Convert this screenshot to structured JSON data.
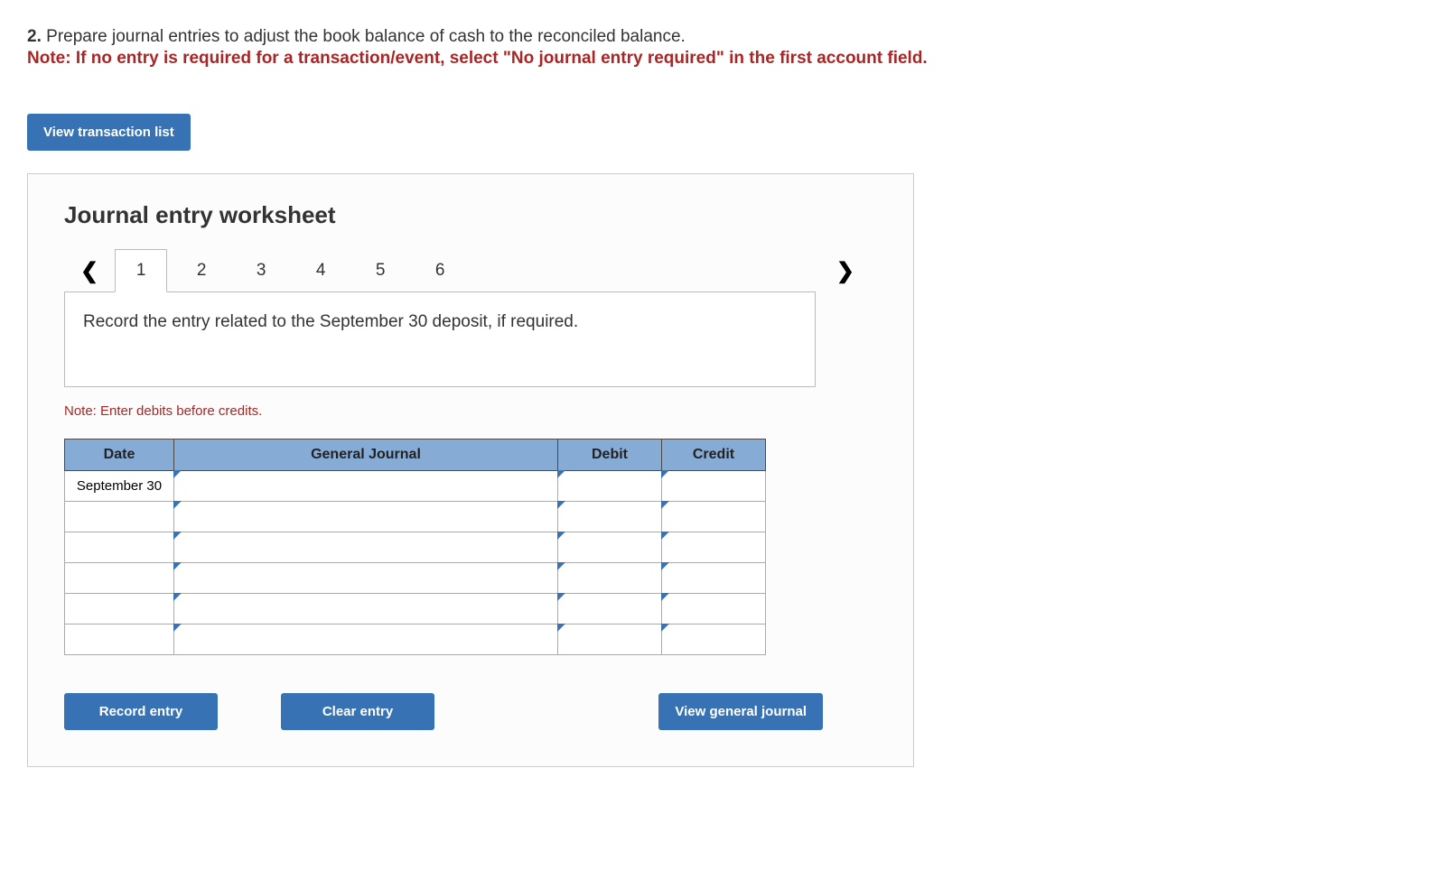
{
  "question": {
    "number": "2.",
    "text": "Prepare journal entries to adjust the book balance of cash to the reconciled balance.",
    "note": "Note: If no entry is required for a transaction/event, select \"No journal entry required\" in the first account field."
  },
  "buttons": {
    "view_transaction_list": "View transaction list",
    "record_entry": "Record entry",
    "clear_entry": "Clear entry",
    "view_general_journal": "View general journal"
  },
  "worksheet": {
    "title": "Journal entry worksheet",
    "tabs": [
      "1",
      "2",
      "3",
      "4",
      "5",
      "6"
    ],
    "active_tab": "1",
    "instruction": "Record the entry related to the September 30 deposit, if required.",
    "credits_note": "Note: Enter debits before credits."
  },
  "table": {
    "headers": {
      "date": "Date",
      "general_journal": "General Journal",
      "debit": "Debit",
      "credit": "Credit"
    },
    "date_value": "September 30"
  }
}
